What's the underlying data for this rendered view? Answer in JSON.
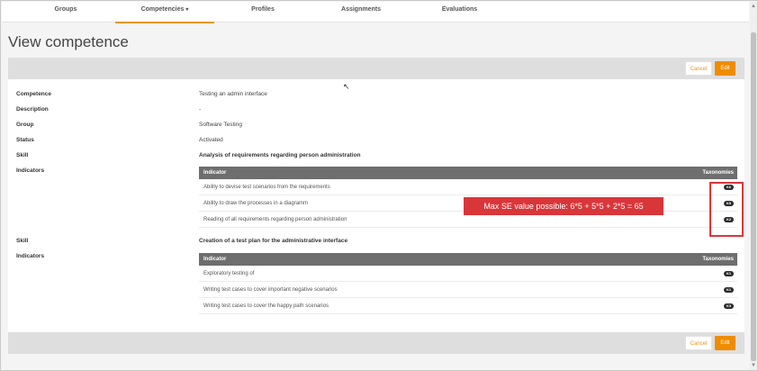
{
  "nav": {
    "items": [
      {
        "label": "Groups"
      },
      {
        "label": "Competencies"
      },
      {
        "label": "Profiles"
      },
      {
        "label": "Assignments"
      },
      {
        "label": "Evaluations"
      }
    ],
    "caret": "▾"
  },
  "page": {
    "title": "View competence"
  },
  "actions": {
    "cancel_label": "Cancel",
    "edit_label": "Edit"
  },
  "fields": {
    "competence": {
      "label": "Competence",
      "value": "Testing an admin interface"
    },
    "description": {
      "label": "Description",
      "value": "-"
    },
    "group": {
      "label": "Group",
      "value": "Software Testing"
    },
    "status": {
      "label": "Status",
      "value": "Activated"
    }
  },
  "skills": [
    {
      "skill_label": "Skill",
      "name": "Analysis of requirements regarding person administration",
      "indicators_label": "Indicators",
      "header_left": "Indicator",
      "header_right": "Taxonomies",
      "rows": [
        {
          "text": "Ability to devise test scenarios from the requirements",
          "tax": "K6"
        },
        {
          "text": "Ability to draw the processes in a diagramm",
          "tax": "K5"
        },
        {
          "text": "Reading of all requirements regarding person administration",
          "tax": "K2"
        }
      ]
    },
    {
      "skill_label": "Skill",
      "name": "Creation of a test plan for the administrative interface",
      "indicators_label": "Indicators",
      "header_left": "Indicator",
      "header_right": "Taxonomies",
      "rows": [
        {
          "text": "Exploratory testing of",
          "tax": "K1"
        },
        {
          "text": "Writing test cases to cover important negative scenarios",
          "tax": "K1"
        },
        {
          "text": "Writing test cases to cover the happy path scenarios",
          "tax": "K3"
        }
      ]
    }
  ],
  "annotation": {
    "text": "Max SE value possible: 6*5 + 5*5 + 2*5 = 65"
  },
  "colors": {
    "accent": "#ef8c00",
    "annotation_red": "#d9363a",
    "table_header": "#6e6e6e"
  }
}
